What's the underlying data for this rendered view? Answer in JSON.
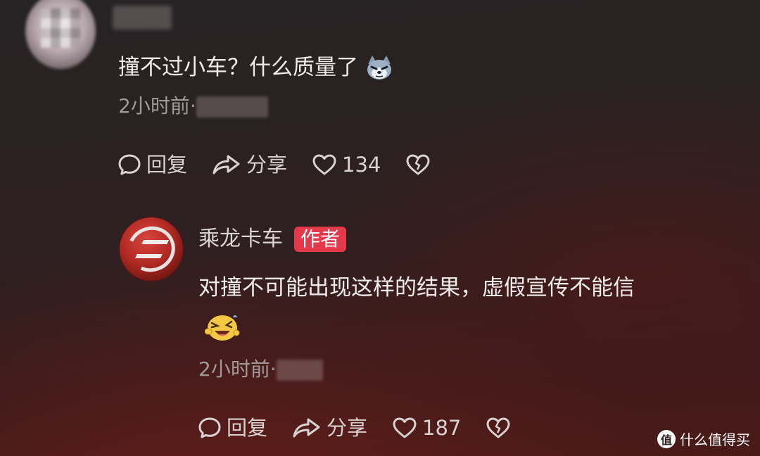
{
  "top_comment": {
    "text": "撞不过小车？什么质量了",
    "emoji": "wolf-emoji-icon",
    "time": "2小时前·",
    "reply_label": "回复",
    "share_label": "分享",
    "like_count": "134"
  },
  "reply": {
    "author": "乘龙卡车",
    "badge": "作者",
    "text": "对撞不可能出现这样的结果，虚假宣传不能信",
    "emoji": "laughing-emoji-icon",
    "time": "2小时前·",
    "reply_label": "回复",
    "share_label": "分享",
    "like_count": "187"
  },
  "watermark": {
    "logo_char": "值",
    "text": "什么值得买"
  },
  "colors": {
    "badge": "#e3394a",
    "text": "#f0ebea",
    "muted": "#a29a9a"
  }
}
